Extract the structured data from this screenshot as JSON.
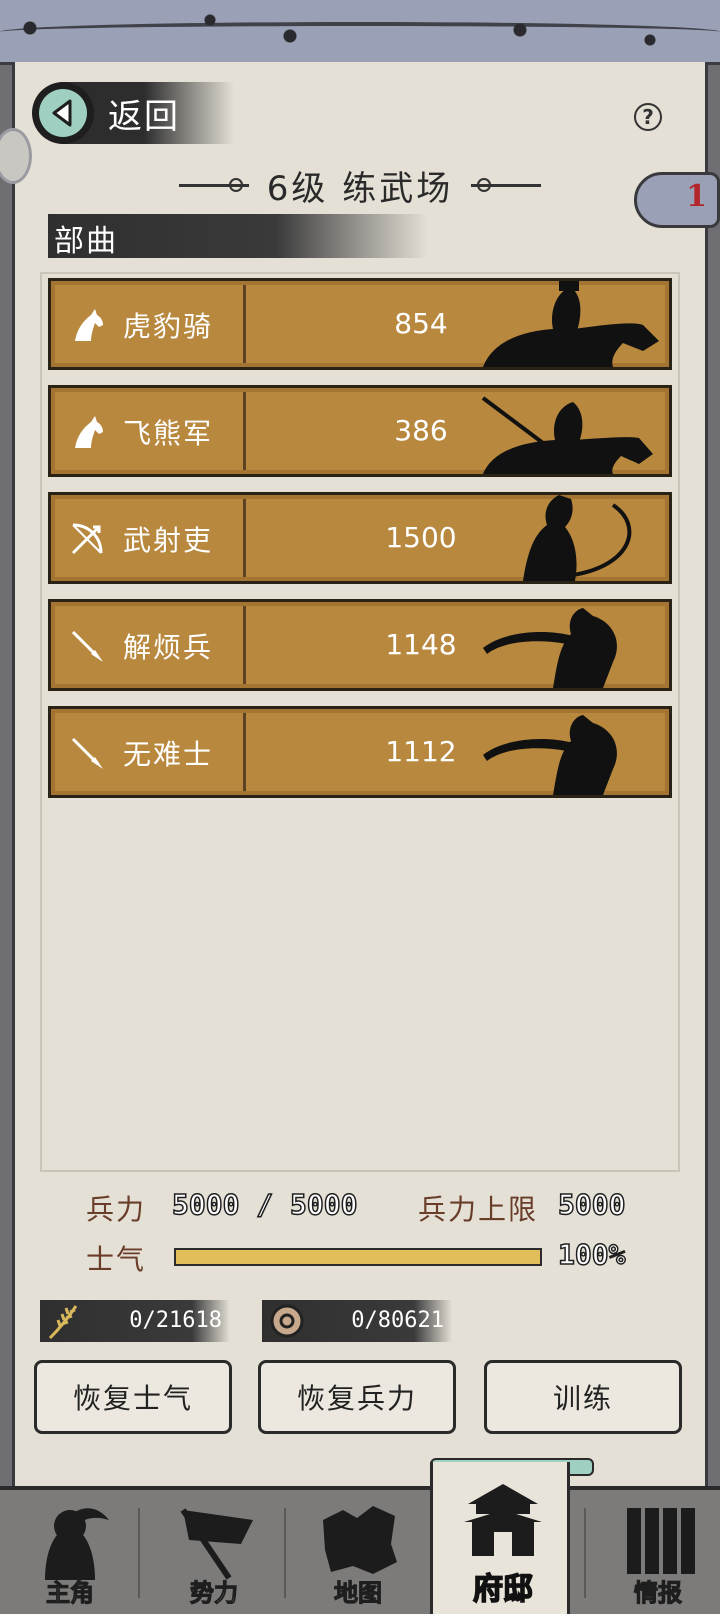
{
  "header": {
    "back_label": "返回",
    "title": "6级 练武场",
    "help_symbol": "?",
    "badge_count": "1"
  },
  "section": {
    "label": "部曲"
  },
  "units": [
    {
      "name": "虎豹骑",
      "count": "854",
      "icon": "horse-icon"
    },
    {
      "name": "飞熊军",
      "count": "386",
      "icon": "horse-icon"
    },
    {
      "name": "武射吏",
      "count": "1500",
      "icon": "bow-icon"
    },
    {
      "name": "解烦兵",
      "count": "1148",
      "icon": "spear-icon"
    },
    {
      "name": "无难士",
      "count": "1112",
      "icon": "spear-icon"
    }
  ],
  "stats": {
    "troops_label": "兵力",
    "troops_value": "5000 / 5000",
    "cap_label": "兵力上限",
    "cap_value": "5000",
    "morale_label": "士气",
    "morale_value": "100%",
    "morale_fraction": 1.0
  },
  "resources": [
    {
      "icon": "grain-icon",
      "value": "0/21618"
    },
    {
      "icon": "coin-icon",
      "value": "0/80621"
    }
  ],
  "actions": {
    "restore_morale": "恢复士气",
    "restore_troops": "恢复兵力",
    "train": "训练"
  },
  "nav": [
    {
      "label": "主角",
      "icon": "hero-icon"
    },
    {
      "label": "势力",
      "icon": "flag-icon"
    },
    {
      "label": "地图",
      "icon": "map-icon"
    },
    {
      "label": "府邸",
      "icon": "mansion-icon",
      "active": true
    },
    {
      "label": "情报",
      "icon": "scroll-icon"
    }
  ],
  "colors": {
    "unit_row": "#b8883e",
    "morale_fill": "#e2be5a",
    "accent_teal": "#9fcfc0",
    "paper": "#e4e0d5"
  }
}
